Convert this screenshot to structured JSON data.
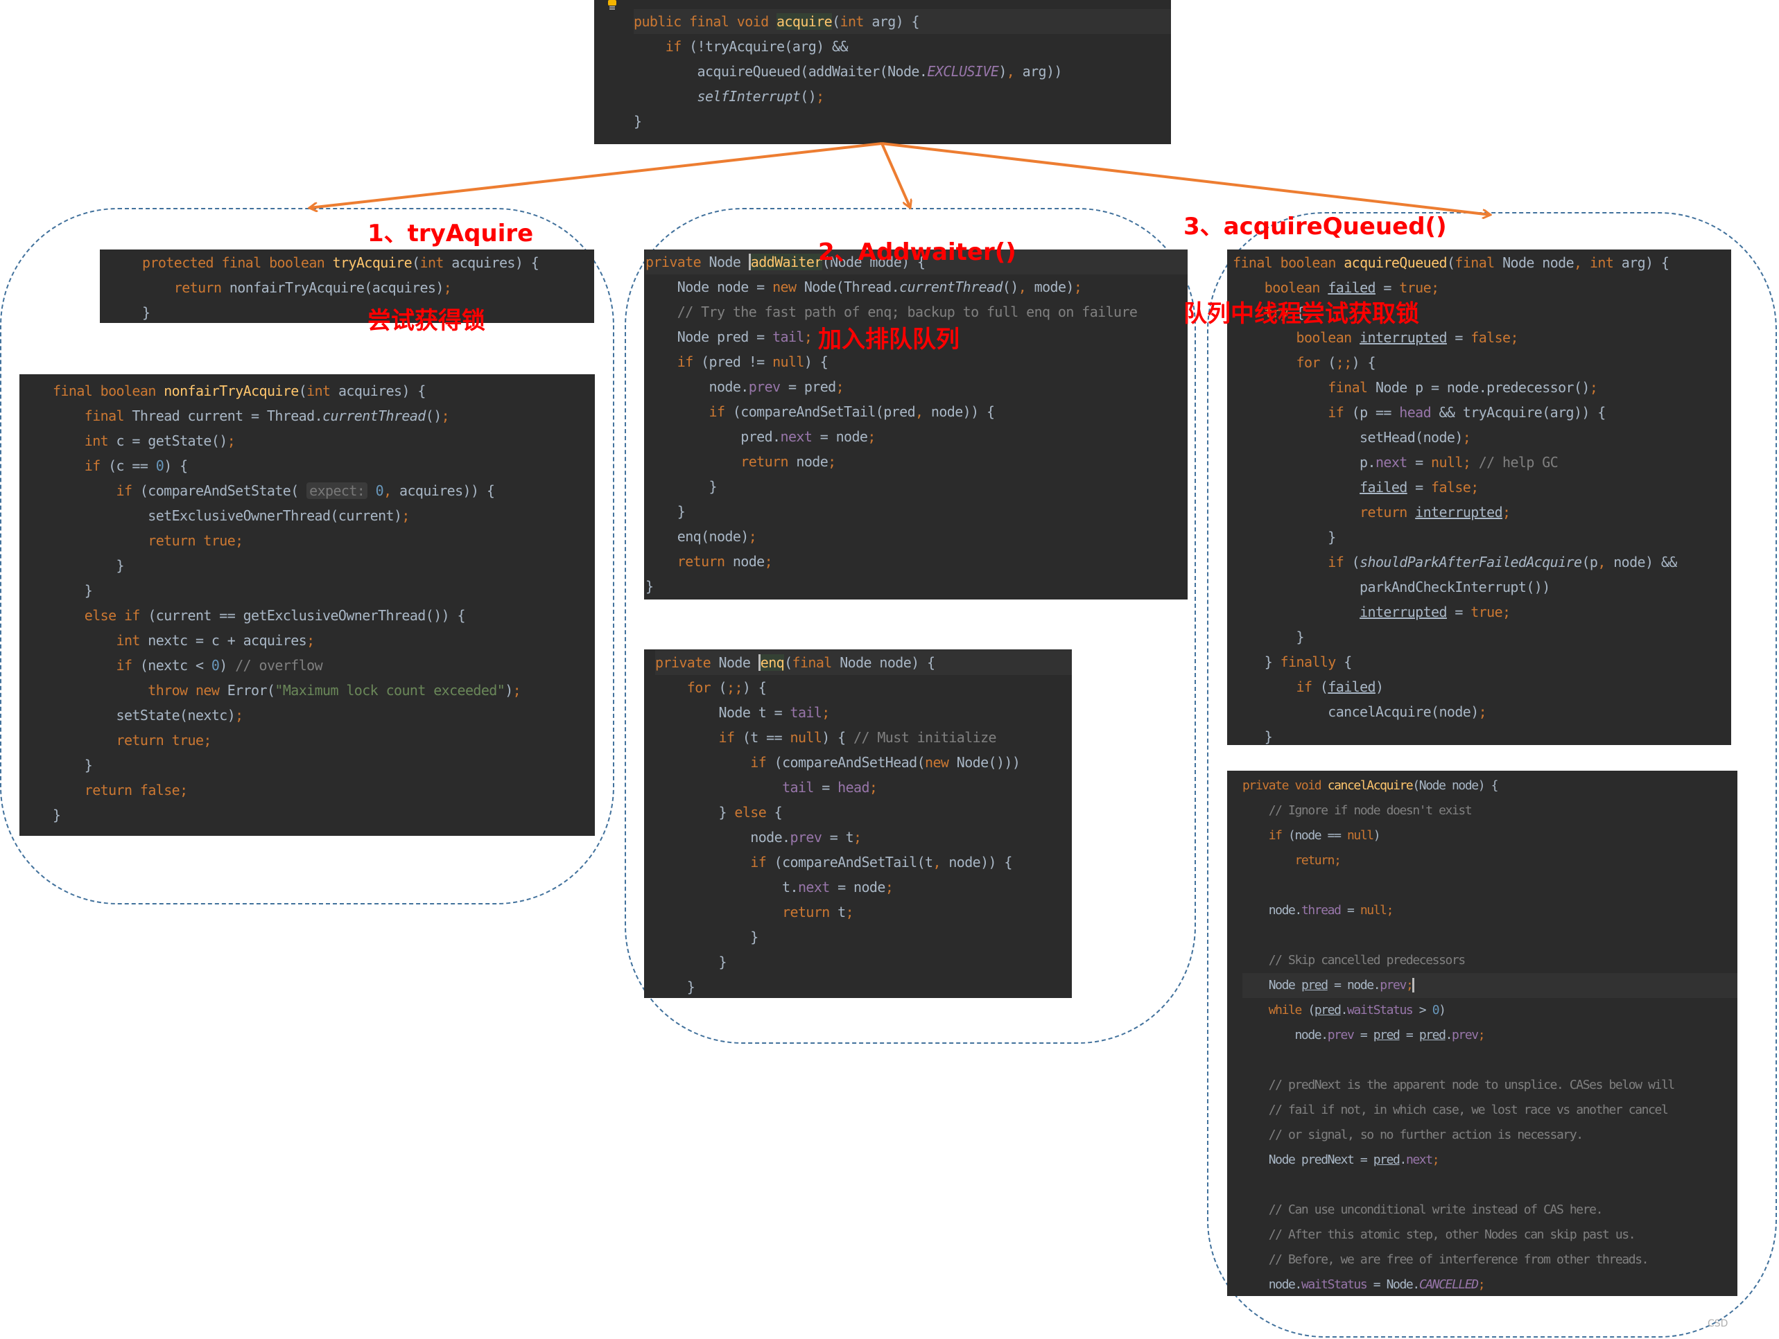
{
  "labels": {
    "step1_title": "1、tryAquire",
    "step1_subtitle": "尝试获得锁",
    "step2_title": "2、Addwaiter()",
    "step2_subtitle": "加入排队队列",
    "step3_title": "3、acquireQueued()",
    "step3_subtitle": "队列中线程尝试获取锁"
  },
  "colors": {
    "label": "#ff0000",
    "arrow": "#ed7d31",
    "container_border": "#41719c",
    "panel_bg": "#2b2b2b"
  },
  "watermark": "CSD",
  "panels": {
    "acquire": [
      "public final void acquire(int arg) {",
      "    if (!tryAcquire(arg) &&",
      "        acquireQueued(addWaiter(Node.EXCLUSIVE), arg))",
      "        selfInterrupt();",
      "}"
    ],
    "tryAcquire": [
      "protected final boolean tryAcquire(int acquires) {",
      "    return nonfairTryAcquire(acquires);",
      "}"
    ],
    "nonfairTryAcquire": [
      "final boolean nonfairTryAcquire(int acquires) {",
      "    final Thread current = Thread.currentThread();",
      "    int c = getState();",
      "    if (c == 0) {",
      "        if (compareAndSetState( expect: 0, acquires)) {",
      "            setExclusiveOwnerThread(current);",
      "            return true;",
      "        }",
      "    }",
      "    else if (current == getExclusiveOwnerThread()) {",
      "        int nextc = c + acquires;",
      "        if (nextc < 0) // overflow",
      "            throw new Error(\"Maximum lock count exceeded\");",
      "        setState(nextc);",
      "        return true;",
      "    }",
      "    return false;",
      "}"
    ],
    "addWaiter": [
      "private Node addWaiter(Node mode) {",
      "    Node node = new Node(Thread.currentThread(), mode);",
      "    // Try the fast path of enq; backup to full enq on failure",
      "    Node pred = tail;",
      "    if (pred != null) {",
      "        node.prev = pred;",
      "        if (compareAndSetTail(pred, node)) {",
      "            pred.next = node;",
      "            return node;",
      "        }",
      "    }",
      "    enq(node);",
      "    return node;",
      "}"
    ],
    "enq": [
      "private Node enq(final Node node) {",
      "    for (;;) {",
      "        Node t = tail;",
      "        if (t == null) { // Must initialize",
      "            if (compareAndSetHead(new Node()))",
      "                tail = head;",
      "        } else {",
      "            node.prev = t;",
      "            if (compareAndSetTail(t, node)) {",
      "                t.next = node;",
      "                return t;",
      "            }",
      "        }",
      "    }"
    ],
    "acquireQueued": [
      "final boolean acquireQueued(final Node node, int arg) {",
      "    boolean failed = true;",
      "    try {",
      "        boolean interrupted = false;",
      "        for (;;) {",
      "            final Node p = node.predecessor();",
      "            if (p == head && tryAcquire(arg)) {",
      "                setHead(node);",
      "                p.next = null; // help GC",
      "                failed = false;",
      "                return interrupted;",
      "            }",
      "            if (shouldParkAfterFailedAcquire(p, node) &&",
      "                parkAndCheckInterrupt())",
      "                interrupted = true;",
      "        }",
      "    } finally {",
      "        if (failed)",
      "            cancelAcquire(node);",
      "    }"
    ],
    "cancelAcquire": [
      "private void cancelAcquire(Node node) {",
      "    // Ignore if node doesn't exist",
      "    if (node == null)",
      "        return;",
      "",
      "    node.thread = null;",
      "",
      "    // Skip cancelled predecessors",
      "    Node pred = node.prev;",
      "    while (pred.waitStatus > 0)",
      "        node.prev = pred = pred.prev;",
      "",
      "    // predNext is the apparent node to unsplice. CASes below will",
      "    // fail if not, in which case, we lost race vs another cancel",
      "    // or signal, so no further action is necessary.",
      "    Node predNext = pred.next;",
      "",
      "    // Can use unconditional write instead of CAS here.",
      "    // After this atomic step, other Nodes can skip past us.",
      "    // Before, we are free of interference from other threads.",
      "    node.waitStatus = Node.CANCELLED;"
    ]
  }
}
